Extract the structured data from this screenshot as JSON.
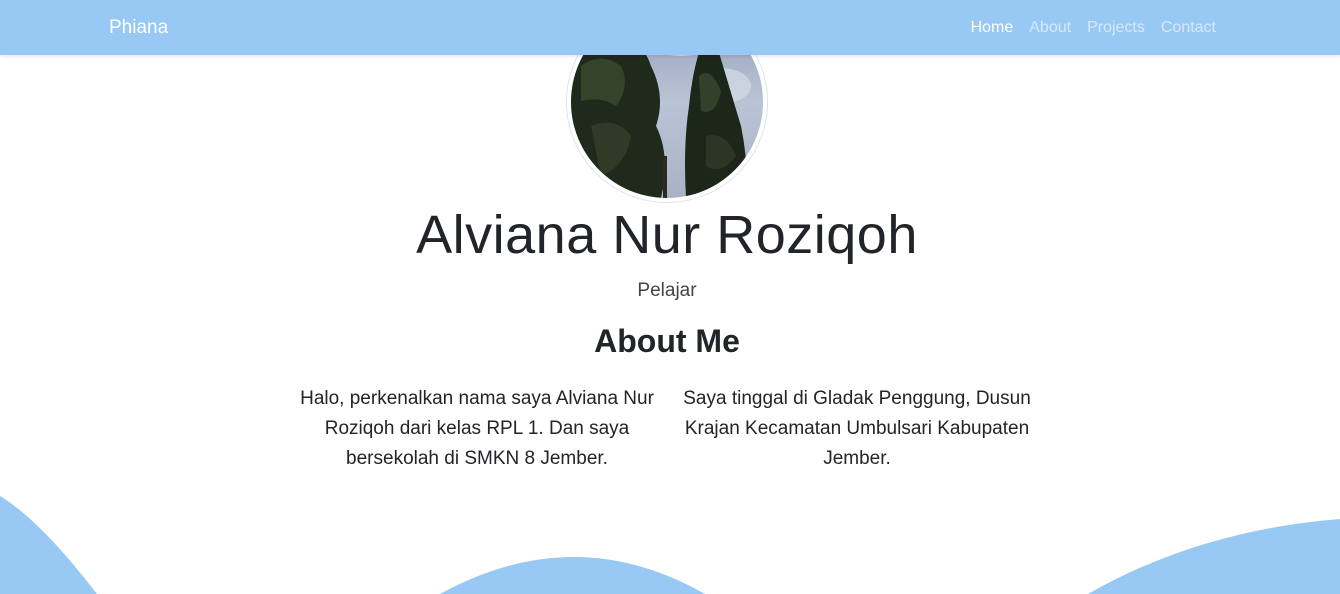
{
  "navbar": {
    "brand": "Phiana",
    "links": [
      {
        "label": "Home",
        "active": true
      },
      {
        "label": "About",
        "active": false
      },
      {
        "label": "Projects",
        "active": false
      },
      {
        "label": "Contact",
        "active": false
      }
    ]
  },
  "profile": {
    "name": "Alviana Nur Roziqoh",
    "role": "Pelajar"
  },
  "about": {
    "title": "About Me",
    "paragraphs": [
      "Halo, perkenalkan nama saya Alviana Nur Roziqoh dari kelas RPL 1. Dan saya bersekolah di SMKN 8 Jember.",
      "Saya tinggal di Gladak Penggung, Dusun Krajan Kecamatan Umbulsari Kabupaten Jember."
    ]
  },
  "colors": {
    "accent": "#98c9f4",
    "text": "#212529"
  }
}
